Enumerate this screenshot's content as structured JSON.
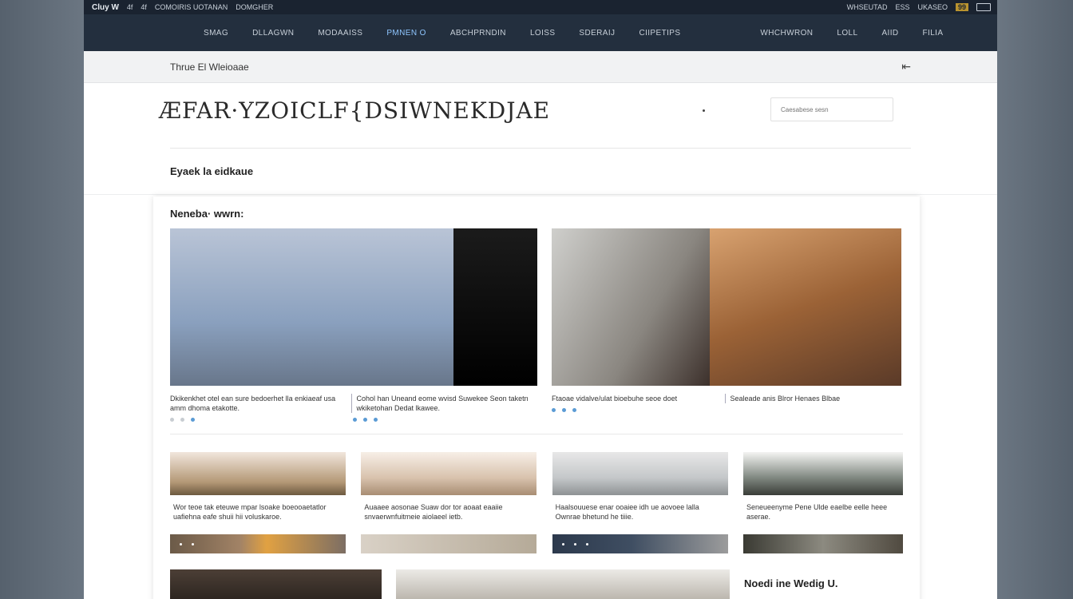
{
  "topbar": {
    "logo": "Cluy W",
    "left_items": [
      "4f",
      "4f",
      "COMOIRIS UOTANAN",
      "DOMGHER"
    ],
    "right_items": [
      "WHSEUTAD",
      "ESS",
      "UKASEO"
    ],
    "badge": "99"
  },
  "nav": {
    "items": [
      "SMAG",
      "DLLAGWN",
      "MODAAISS",
      "PMNEN  O",
      "ABCHPRNDIN",
      "LOISS",
      "SDERAIJ",
      "CIIPETIPS"
    ],
    "right_items": [
      "WHCHWRON",
      "LOLL",
      "AIID",
      "FILIA"
    ],
    "active_index": 3
  },
  "subheader": {
    "breadcrumb": "Thrue El Wleioaae"
  },
  "brand": {
    "wordmark": "ÆFAR·YZOICLF{DSIWNEKDJAE",
    "search_placeholder": "Caesabese sesn"
  },
  "section": {
    "title": "Eyaek la eidkaue"
  },
  "content": {
    "label": "Neneba· wwrn:",
    "big_cards": [
      {
        "captions": [
          "Dkikenkhet otel ean sure bedoerhet lla enkiaeaf usa amm dhoma etakotte.",
          "Cohol han Uneand eome wvisd Suwekee Seon taketn wkiketohan Dedat lkawee."
        ]
      },
      {
        "captions": [
          "Ftaoae vidalve/ulat bioebuhe seoe doet",
          "Sealeade anis Blror Henaes Blbae"
        ]
      }
    ],
    "small_cards": [
      {
        "caption": "Wor teoe tak eteuwe mpar lsoake boeooaetatlor uafiehna eafe shuii hii voluskaroe."
      },
      {
        "caption": "Auaaee aosonae Suaw dor tor aoaat eaaiie snvaerwnfuitmeie aiolaeel ietb."
      },
      {
        "caption": "Haalsouuese enar ooaiee idh ue aovoee lalla Ownrae bhetund he tiiie."
      },
      {
        "caption": "Seneueenyme Pene Ulde eaelbe eelle heee aserae."
      }
    ],
    "feature_title": "Noedi ine Wedig U."
  }
}
